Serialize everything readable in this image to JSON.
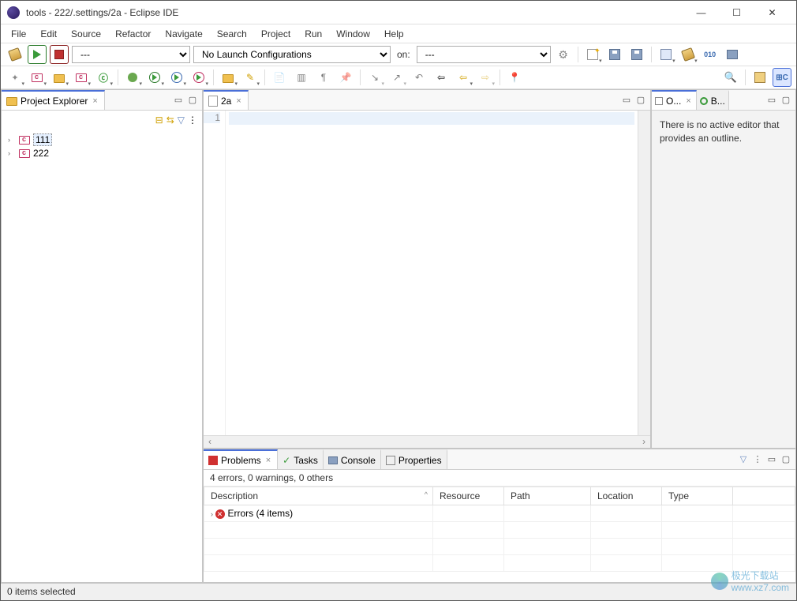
{
  "window": {
    "title": "tools - 222/.settings/2a - Eclipse IDE"
  },
  "menu": [
    "File",
    "Edit",
    "Source",
    "Refactor",
    "Navigate",
    "Search",
    "Project",
    "Run",
    "Window",
    "Help"
  ],
  "launch": {
    "mode_combo": "---",
    "config_combo": "No Launch Configurations",
    "on_label": "on:",
    "target_combo": "---"
  },
  "project_explorer": {
    "title": "Project Explorer",
    "items": [
      {
        "name": "111",
        "selected": true
      },
      {
        "name": "222",
        "selected": false
      }
    ]
  },
  "editor": {
    "tab_label": "2a",
    "line_number": "1",
    "content": ""
  },
  "outline": {
    "tab1": "O...",
    "tab2": "B...",
    "message": "There is no active editor that provides an outline."
  },
  "bottom": {
    "tabs": [
      "Problems",
      "Tasks",
      "Console",
      "Properties"
    ],
    "summary": "4 errors, 0 warnings, 0 others",
    "columns": [
      "Description",
      "Resource",
      "Path",
      "Location",
      "Type"
    ],
    "error_row": "Errors (4 items)"
  },
  "status": {
    "text": "0 items selected"
  },
  "watermark": {
    "line1": "极光下载站",
    "line2": "www.xz7.com"
  }
}
